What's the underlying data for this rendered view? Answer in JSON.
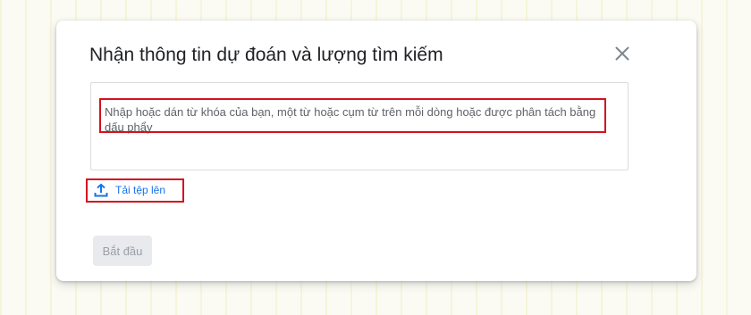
{
  "dialog": {
    "title": "Nhận thông tin dự đoán và lượng tìm kiếm",
    "close_icon": "close-icon",
    "keywords_input": {
      "value": "",
      "placeholder": "Nhập hoặc dán từ khóa của bạn, một từ hoặc cụm từ trên mỗi dòng hoặc được phân tách bằng dấu phẩy"
    },
    "upload": {
      "icon": "upload-icon",
      "label": "Tải tệp lên"
    },
    "start_button": {
      "label": "Bắt đầu",
      "state": "disabled"
    }
  },
  "colors": {
    "link_blue": "#1a73e8",
    "highlight_red": "#d3131f",
    "title_text": "#202124",
    "disabled_button_bg": "#e8eaed",
    "disabled_button_text": "#9aa0a6"
  }
}
